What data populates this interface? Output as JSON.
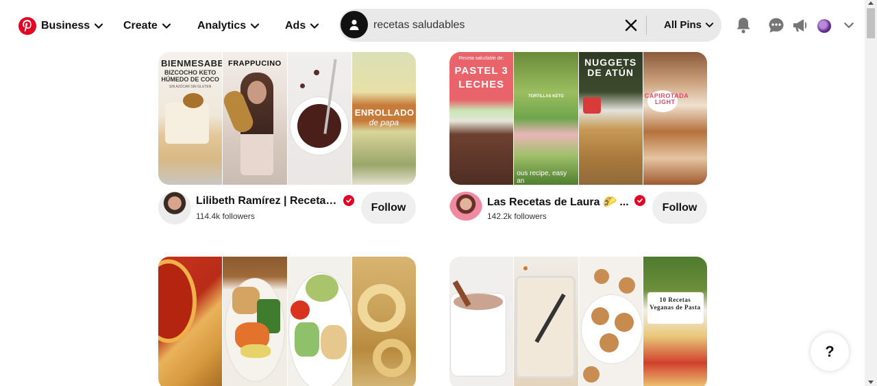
{
  "header": {
    "nav": [
      {
        "label": "Business"
      },
      {
        "label": "Create"
      },
      {
        "label": "Analytics"
      },
      {
        "label": "Ads"
      }
    ],
    "search": {
      "value": "recetas saludables",
      "filter_label": "All Pins"
    },
    "icons": [
      "pinterest-logo-icon",
      "notifications-icon",
      "messages-icon",
      "megaphone-icon",
      "profile-avatar",
      "chevron-down-icon"
    ]
  },
  "cards": [
    {
      "name": "Lilibeth Ramírez | Recetas...",
      "followers": "114.4k followers",
      "follow_label": "Follow",
      "tiles": [
        {
          "caption": "BIENMESABE",
          "sub": "BIZCOCHO KETO HÚMEDO DE COCO",
          "note": "SIN AZÚCAR SIN GLUTEN"
        },
        {
          "caption": "FRAPPUCINO",
          "sub": "",
          "note": ""
        },
        {
          "caption": "",
          "sub": "",
          "note": ""
        },
        {
          "caption": "ENROLLADO",
          "sub": "de papa",
          "note": ""
        }
      ]
    },
    {
      "name": "Las Recetas de Laura 🌮 ...",
      "followers": "142.2k followers",
      "follow_label": "Follow",
      "tiles": [
        {
          "caption": "PASTEL 3 LECHES",
          "sub": "Receta saludable de:",
          "note": ""
        },
        {
          "caption": "",
          "sub": "TORTILLAS KETO",
          "note": "ous recipe, easy an"
        },
        {
          "caption": "NUGGETS DE ATÚN",
          "sub": "",
          "note": ""
        },
        {
          "caption": "CAPIROTADA LIGHT",
          "sub": "",
          "note": ""
        }
      ]
    },
    {
      "name": "",
      "followers": "",
      "follow_label": "",
      "tiles": [
        {
          "caption": "",
          "sub": "",
          "note": ""
        },
        {
          "caption": "",
          "sub": "",
          "note": ""
        },
        {
          "caption": "",
          "sub": "",
          "note": ""
        },
        {
          "caption": "",
          "sub": "",
          "note": ""
        }
      ]
    },
    {
      "name": "",
      "followers": "",
      "follow_label": "",
      "tiles": [
        {
          "caption": "",
          "sub": "",
          "note": ""
        },
        {
          "caption": "",
          "sub": "",
          "note": ""
        },
        {
          "caption": "",
          "sub": "",
          "note": ""
        },
        {
          "caption": "10 Recetas Veganas de Pasta",
          "sub": "",
          "note": ""
        }
      ]
    }
  ],
  "help": {
    "label": "?"
  },
  "colors": {
    "brand": "#e60023",
    "search_bg": "#e9e9e9",
    "follow_bg": "#efefef"
  }
}
